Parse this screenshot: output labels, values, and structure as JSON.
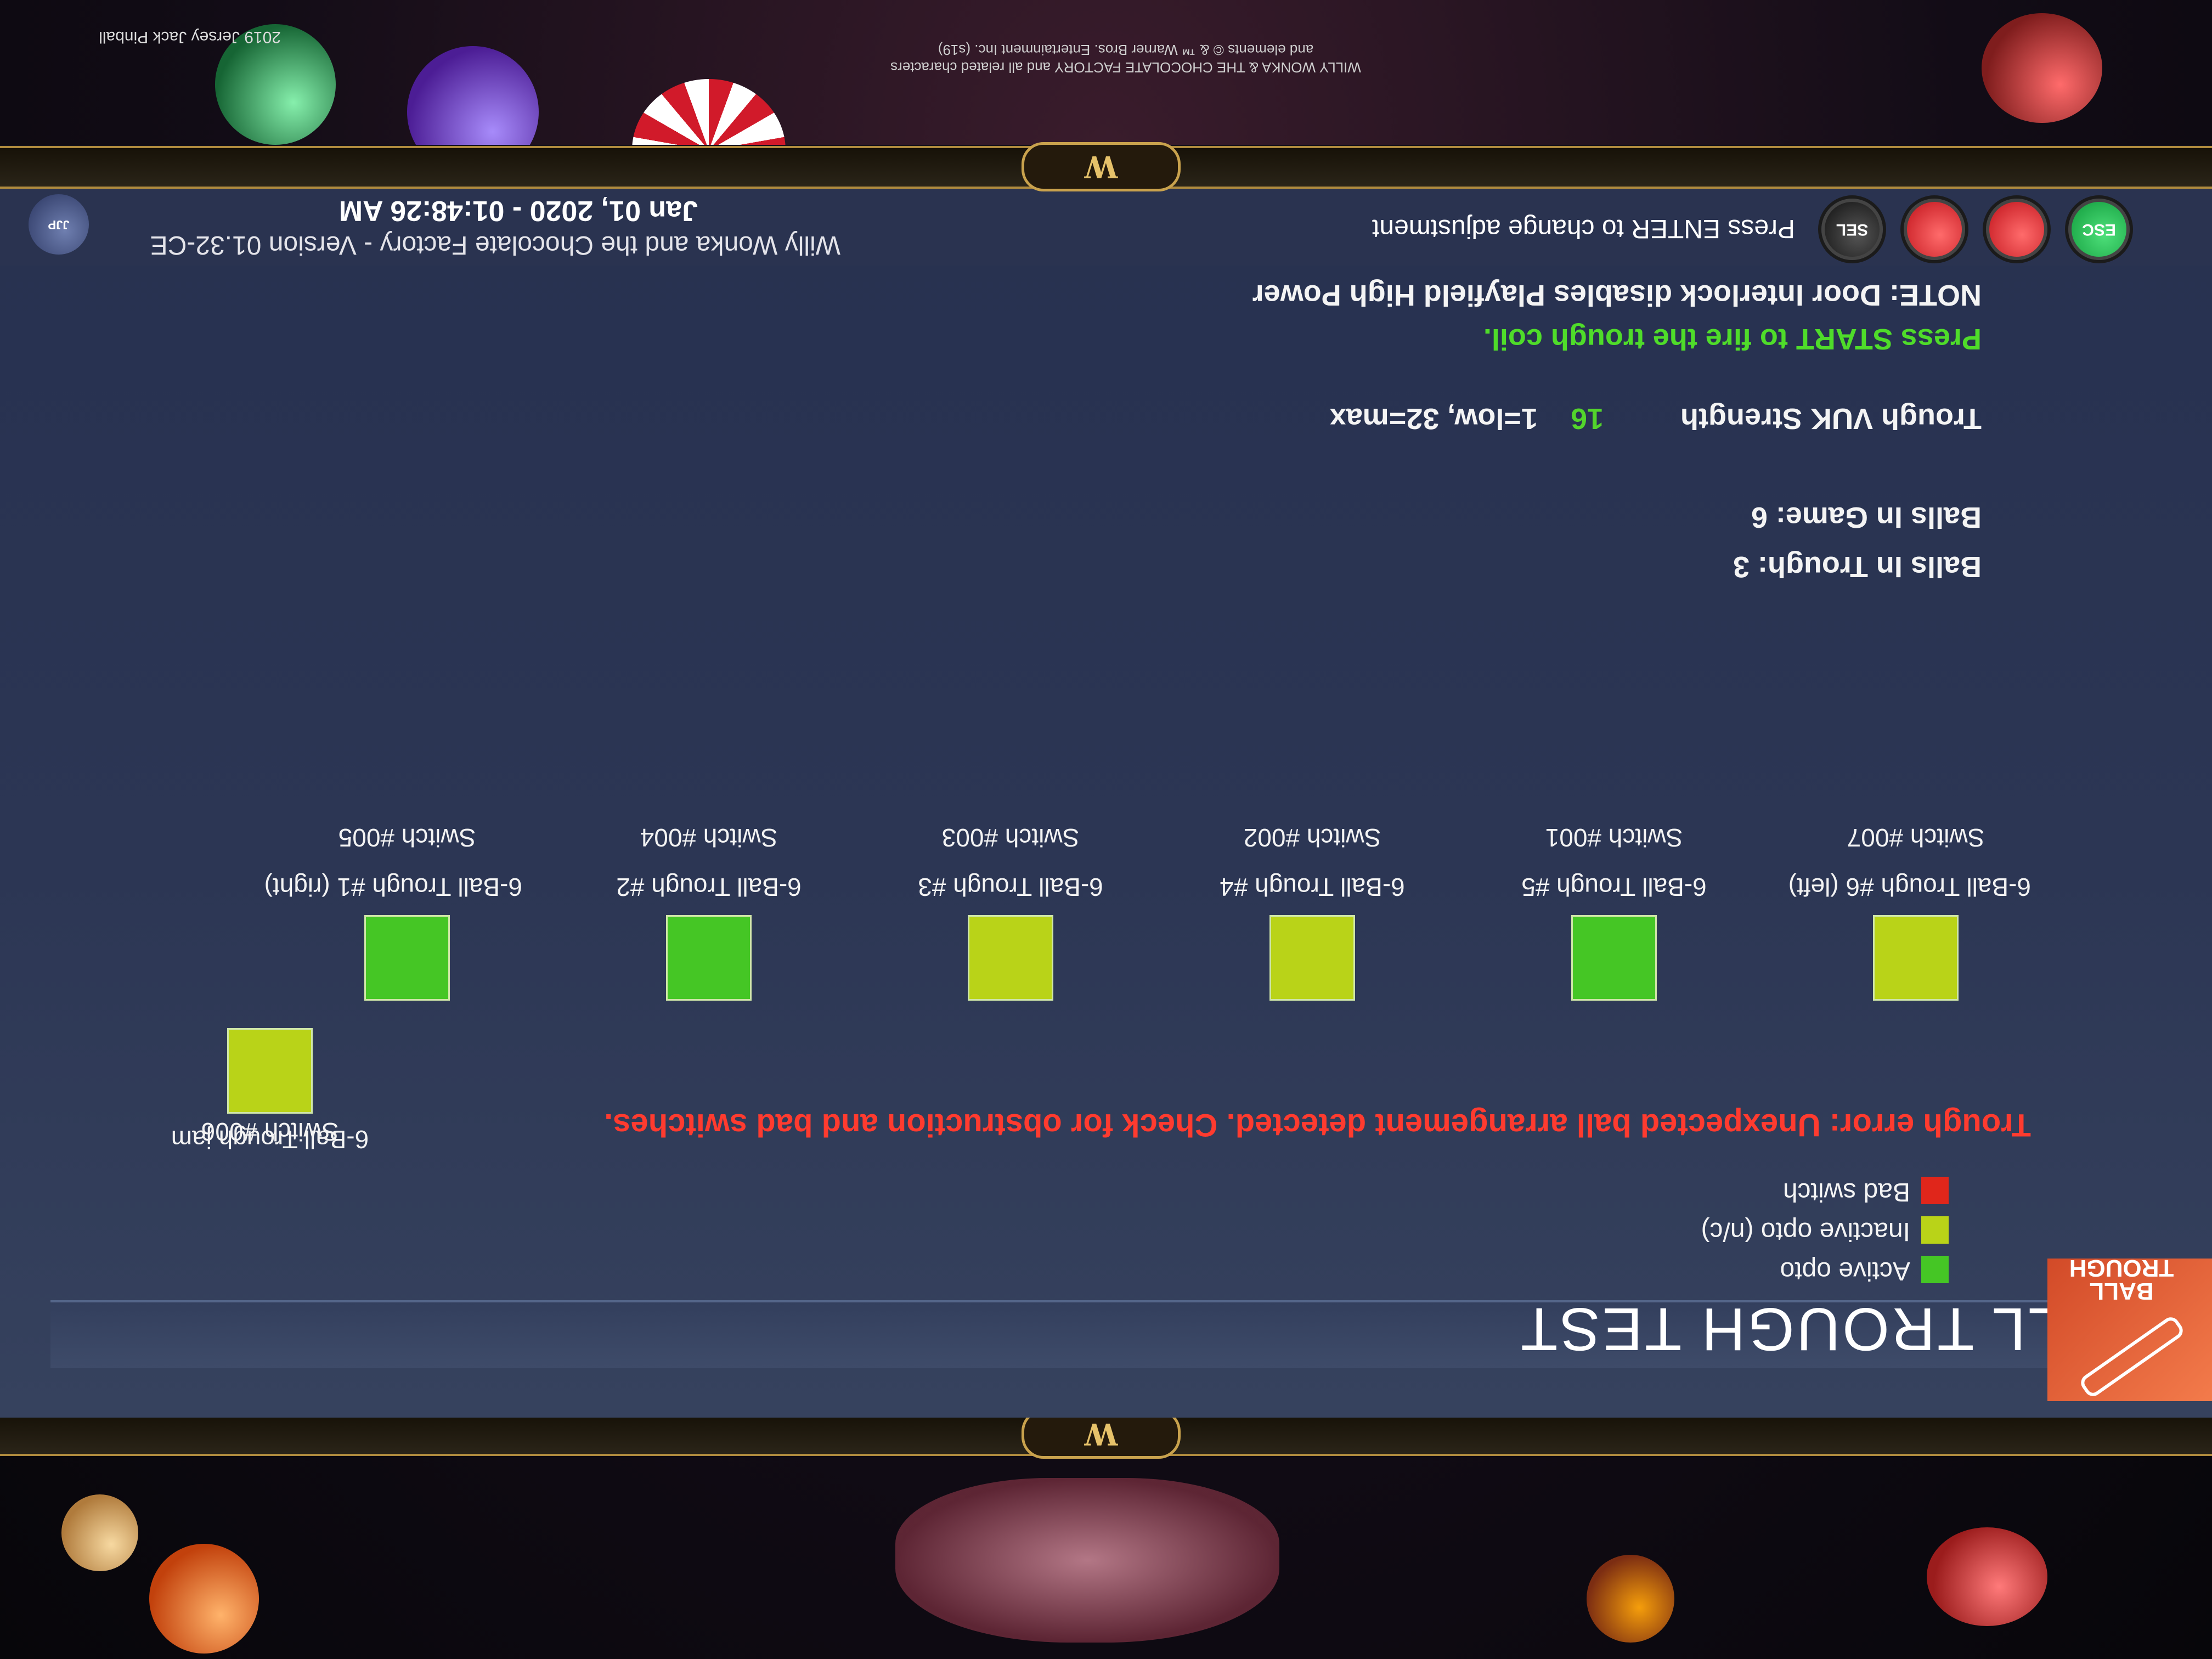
{
  "screen": {
    "title": "BALL TROUGH TEST",
    "icon_label": "BALL TROUGH",
    "legend": [
      {
        "label": "Active opto",
        "color": "#45c625"
      },
      {
        "label": "Inactive opto (n/c)",
        "color": "#b9d318"
      },
      {
        "label": "Bad switch",
        "color": "#e0261b"
      }
    ],
    "error": "Trough error: Unexpected ball arrangement detected. Check for obstruction and bad switches.",
    "jam": {
      "name": "6-Ball Trough jam",
      "switch": "Switch #006",
      "state": "inactive"
    },
    "switches": [
      {
        "name": "6-Ball Trough #1 (right)",
        "switch": "Switch #005",
        "state": "active"
      },
      {
        "name": "6-Ball Trough #2",
        "switch": "Switch #004",
        "state": "active"
      },
      {
        "name": "6-Ball Trough #3",
        "switch": "Switch #003",
        "state": "inactive"
      },
      {
        "name": "6-Ball Trough #4",
        "switch": "Switch #002",
        "state": "inactive"
      },
      {
        "name": "6-Ball Trough #5",
        "switch": "Switch #001",
        "state": "active"
      },
      {
        "name": "6-Ball Trough #6 (left)",
        "switch": "Switch #007",
        "state": "inactive"
      }
    ],
    "balls_in_trough": "Balls In Trough: 3",
    "balls_in_game": "Balls In Game: 6",
    "vuk": {
      "label": "Trough VUK Strength",
      "value": "16",
      "range": "1=low, 32=max"
    },
    "press_start": "Press START to fire the trough coil.",
    "note": "NOTE: Door Interlock disables Playfield High Power"
  },
  "bottom_bar": {
    "buttons": [
      {
        "label": "ESC",
        "color": "#1fa94a"
      },
      {
        "label": "",
        "color": "#d8252b"
      },
      {
        "label": "",
        "color": "#d8252b"
      },
      {
        "label": "SEL",
        "color": "#222222"
      }
    ],
    "hint": "Press ENTER to change adjustment",
    "game_version": "Willy Wonka and the Chocolate Factory - Version 01.32-CE",
    "datetime": "Jan 01, 2020 - 01:48:26 AM",
    "logo": "JERSEY JACK PINBALL"
  },
  "bezel": {
    "badge": "W",
    "copyright_line1": "WILLY WONKA & THE CHOCOLATE FACTORY and all related characters",
    "copyright_line2": "and elements © & ™ Warner Bros. Entertainment Inc. (s19)",
    "credit": "2019 Jersey Jack Pinball"
  }
}
